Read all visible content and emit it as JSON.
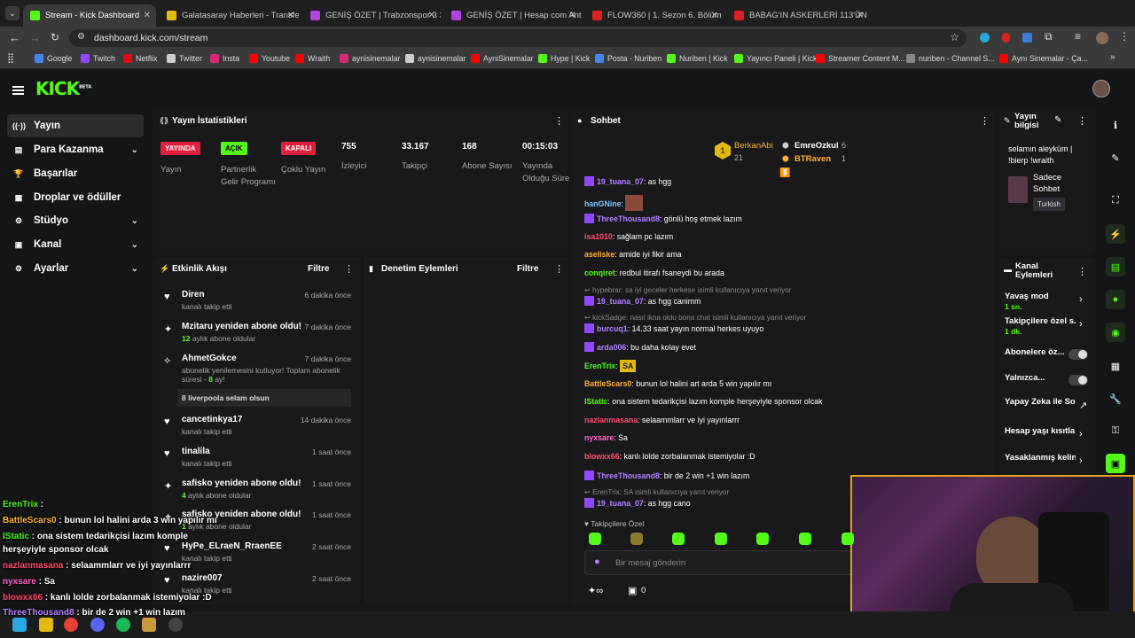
{
  "browser": {
    "tabs": [
      {
        "label": "Stream - Kick Dashboard",
        "color": "#53fc18",
        "active": true
      },
      {
        "label": "Galatasaray Haberleri - Transfe",
        "color": "#e3b90f"
      },
      {
        "label": "GENİŞ ÖZET | Trabzonspor 3 3",
        "color": "#b044e0"
      },
      {
        "label": "GENİŞ ÖZET | Hesap com Antal",
        "color": "#b044e0"
      },
      {
        "label": "FLOW360 | 1. Sezon 6. Bölüm |",
        "color": "#e02020"
      },
      {
        "label": "BABAG'IN ASKERLERİ 113'ÜN P",
        "color": "#e02020"
      }
    ],
    "url": "dashboard.kick.com/stream",
    "bookmarks": [
      {
        "label": "Google",
        "color": "#4285f4"
      },
      {
        "label": "Twitch",
        "color": "#9146ff"
      },
      {
        "label": "Netflix",
        "color": "#e50914"
      },
      {
        "label": "Twitter",
        "color": "#cccccc"
      },
      {
        "label": "Insta",
        "color": "#d62976"
      },
      {
        "label": "Youtube",
        "color": "#ff0000"
      },
      {
        "label": "Wraith",
        "color": "#ff0000"
      },
      {
        "label": "aynisinemalar",
        "color": "#d62976"
      },
      {
        "label": "aynisinemalar",
        "color": "#cccccc"
      },
      {
        "label": "AyniSinemalar",
        "color": "#ff0000"
      },
      {
        "label": "Hype | Kick",
        "color": "#53fc18"
      },
      {
        "label": "Posta - Nuriben",
        "color": "#4285f4"
      },
      {
        "label": "Nuriben | Kick",
        "color": "#53fc18"
      },
      {
        "label": "Yayıncı Paneli | Kick",
        "color": "#53fc18"
      },
      {
        "label": "Streamer Content M...",
        "color": "#ff0000"
      },
      {
        "label": "nuriben - Channel S...",
        "color": "#888888"
      },
      {
        "label": "Aynı Sinemalar - Ça...",
        "color": "#ff0000"
      }
    ]
  },
  "app": {
    "logo": "KICK",
    "logo_sup": "BETA"
  },
  "sidebar": [
    {
      "label": "Yayın",
      "icon": "((·))",
      "active": true
    },
    {
      "label": "Para Kazanma",
      "icon": "▤",
      "chev": true
    },
    {
      "label": "Başarılar",
      "icon": "🏆"
    },
    {
      "label": "Droplar ve ödüller",
      "icon": "▦"
    },
    {
      "label": "Stüdyo",
      "icon": "⚙",
      "chev": true
    },
    {
      "label": "Kanal",
      "icon": "▣",
      "chev": true
    },
    {
      "label": "Ayarlar",
      "icon": "⚙",
      "chev": true
    }
  ],
  "stats": {
    "title": "Yayın İstatistikleri",
    "items": [
      {
        "badge": "YAYINDA",
        "badge_color": "#e01f3d",
        "label": "Yayın"
      },
      {
        "badge": "AÇIK",
        "badge_color": "#53fc18",
        "label": "Partnerlik Gelir Programı"
      },
      {
        "badge": "KAPALI",
        "badge_color": "#e01f3d",
        "label": "Çoklu Yayın"
      },
      {
        "value": "755",
        "label": "İzleyici"
      },
      {
        "value": "33.167",
        "label": "Takipçi"
      },
      {
        "value": "168",
        "label": "Abone Sayısı"
      },
      {
        "value": "00:15:03",
        "label": "Yayında Olduğu Süre"
      }
    ]
  },
  "activity": {
    "title": "Etkinlik Akışı",
    "filter": "Filtre",
    "events": [
      {
        "icon": "♥",
        "name": "Diren",
        "sub": "kanalı takip etti",
        "time": "6 dakika önce"
      },
      {
        "icon": "✦",
        "name": "Mzitaru yeniden abone oldu!",
        "sub_num": "12",
        "sub": "aylık abone oldular",
        "time": "7 dakika önce"
      },
      {
        "icon": "⟡",
        "name": "AhmetGokce",
        "sub": "abonelik yenilemesini kutluyor! Toplam abonelik süresi - ",
        "sub_num": "8",
        "sub2": " ay!",
        "msg": "8 liverpoola selam olsun",
        "time": "7 dakika önce"
      },
      {
        "icon": "♥",
        "name": "cancetinkya17",
        "sub": "kanalı takip etti",
        "time": "14 dakika önce"
      },
      {
        "icon": "♥",
        "name": "tinalila",
        "sub": "kanalı takip etti",
        "time": "1 saat önce"
      },
      {
        "icon": "✦",
        "name": "safisko yeniden abone oldu!",
        "sub_num": "4",
        "sub": "aylık abone oldular",
        "time": "1 saat önce"
      },
      {
        "icon": "✦",
        "name": "safisko yeniden abone oldu!",
        "sub_num": "1",
        "sub": "aylık abone oldular",
        "time": "1 saat önce"
      },
      {
        "icon": "♥",
        "name": "HyPe_ELraeN_RraenEE",
        "sub": "kanalı takip etti",
        "time": "2 saat önce"
      },
      {
        "icon": "♥",
        "name": "nazire007",
        "sub": "kanalı takip etti",
        "time": "2 saat önce"
      }
    ]
  },
  "moderation": {
    "title": "Denetim Eylemleri",
    "filter": "Filtre"
  },
  "chat": {
    "title": "Sohbet",
    "top": [
      {
        "name": "BerkanAbi",
        "rank": "1",
        "count": "21"
      },
      {
        "name": "EmreOzkul",
        "count": "6"
      },
      {
        "name": "BTRaven",
        "count": "1"
      }
    ],
    "lines": [
      {
        "user": "19_tuana_07",
        "color": "#b180ff",
        "text": "as hgg"
      },
      {
        "user": "hanGNine",
        "color": "#7ec8ff",
        "text": ""
      },
      {
        "user": "ThreeThousand8",
        "color": "#b180ff",
        "text": "gönlü hoş etmek lazım"
      },
      {
        "user": "isa1010",
        "color": "#ff4d6d",
        "text": "sağlam pc lazım"
      },
      {
        "user": "aseliske",
        "color": "#ffb02e",
        "text": "amide iyi fikir ama"
      },
      {
        "user": "conqiret",
        "color": "#53fc18",
        "text": "redbul itirafı fsaneydi bu arada"
      },
      {
        "reply": "hypebrar: sa iyi geceler herkese isimli kullanıcıya yanıt veriyor"
      },
      {
        "user": "19_tuana_07",
        "color": "#b180ff",
        "text": "as hgg canimm"
      },
      {
        "reply": "kickSadge: nasıl ikna oldu bona chat isimli kullanıcıya yanıt veriyor"
      },
      {
        "user": "burcuq1",
        "color": "#b180ff",
        "text": "14.33 saat yayın normal herkes uyuyo"
      },
      {
        "user": "arda006",
        "color": "#b180ff",
        "text": "bu daha kolay evet"
      },
      {
        "user": "ErenTrix",
        "color": "#53fc18",
        "text": "SA"
      },
      {
        "user": "BattleScars0",
        "color": "#ffb02e",
        "text": "bunun lol halini art arda 5 win yapılır mı"
      },
      {
        "user": "IStatic",
        "color": "#53fc18",
        "text": "ona sistem tedarikçisi lazım komple herşeyiyle sponsor olcak"
      },
      {
        "user": "nazlanmasana",
        "color": "#ff4d6d",
        "text": "selaammlarr ve iyi yayınlarrr"
      },
      {
        "user": "nyxsare",
        "color": "#ff66cc",
        "text": "Sa"
      },
      {
        "user": "blowxx66",
        "color": "#ff4d6d",
        "text": "kanlı lolde zorbalanmak istemiyolar :D"
      },
      {
        "user": "ThreeThousand8",
        "color": "#b180ff",
        "text": "bir de 2 win +1 win lazım"
      },
      {
        "reply": "ErenTrix: SA isimli kullanıcıya yanıt veriyor"
      },
      {
        "user": "19_tuana_07",
        "color": "#b180ff",
        "text": "as hgg cano"
      }
    ],
    "followers_only": "Takipçilere Özel",
    "placeholder": "Bir mesaj gönderin",
    "counter": "0"
  },
  "stream_info": {
    "title": "Yayın bilgisi",
    "stream_title": "selamın aleyküm | !bierp !wraith",
    "category": "Sadece Sohbet",
    "tag": "Turkish"
  },
  "channel_actions": {
    "title": "Kanal Eylemleri",
    "items": [
      {
        "label": "Yavaş mod",
        "sub": "1 sn."
      },
      {
        "label": "Takipçilere özel s...",
        "sub": "1 dk."
      },
      {
        "label": "Abonelere öz...",
        "toggle": true
      },
      {
        "label": "Yalnızca...",
        "toggle": true
      },
      {
        "label": "Yapay Zeka ile Sohbet Denetimi"
      },
      {
        "label": "Hesap yaşı kısıtla"
      },
      {
        "label": "Yasaklanmış kelin"
      }
    ]
  },
  "overlay": [
    {
      "user": "ErenTrix",
      "color": "#53fc18",
      "text": ""
    },
    {
      "user": "BattleScars0",
      "color": "#ffb02e",
      "text": "bunun lol halini arda 3 win yapılır mı"
    },
    {
      "user": "IStatic",
      "color": "#53fc18",
      "text": "ona sistem tedarikçisi lazım komple"
    },
    {
      "user": "",
      "color": "#ffffff",
      "text": "herşeyiyle sponsor olcak"
    },
    {
      "user": "nazlanmasana",
      "color": "#ff4d6d",
      "text": "selaammlarr ve iyi yayınlarrr"
    },
    {
      "user": "nyxsare",
      "color": "#ff66cc",
      "text": "Sa"
    },
    {
      "user": "blowxx66",
      "color": "#ff4d6d",
      "text": "kanlı lolde zorbalanmak istemiyolar :D"
    },
    {
      "user": "ThreeThousand8",
      "color": "#b180ff",
      "text": "bir de 2 win +1 win lazım"
    }
  ]
}
